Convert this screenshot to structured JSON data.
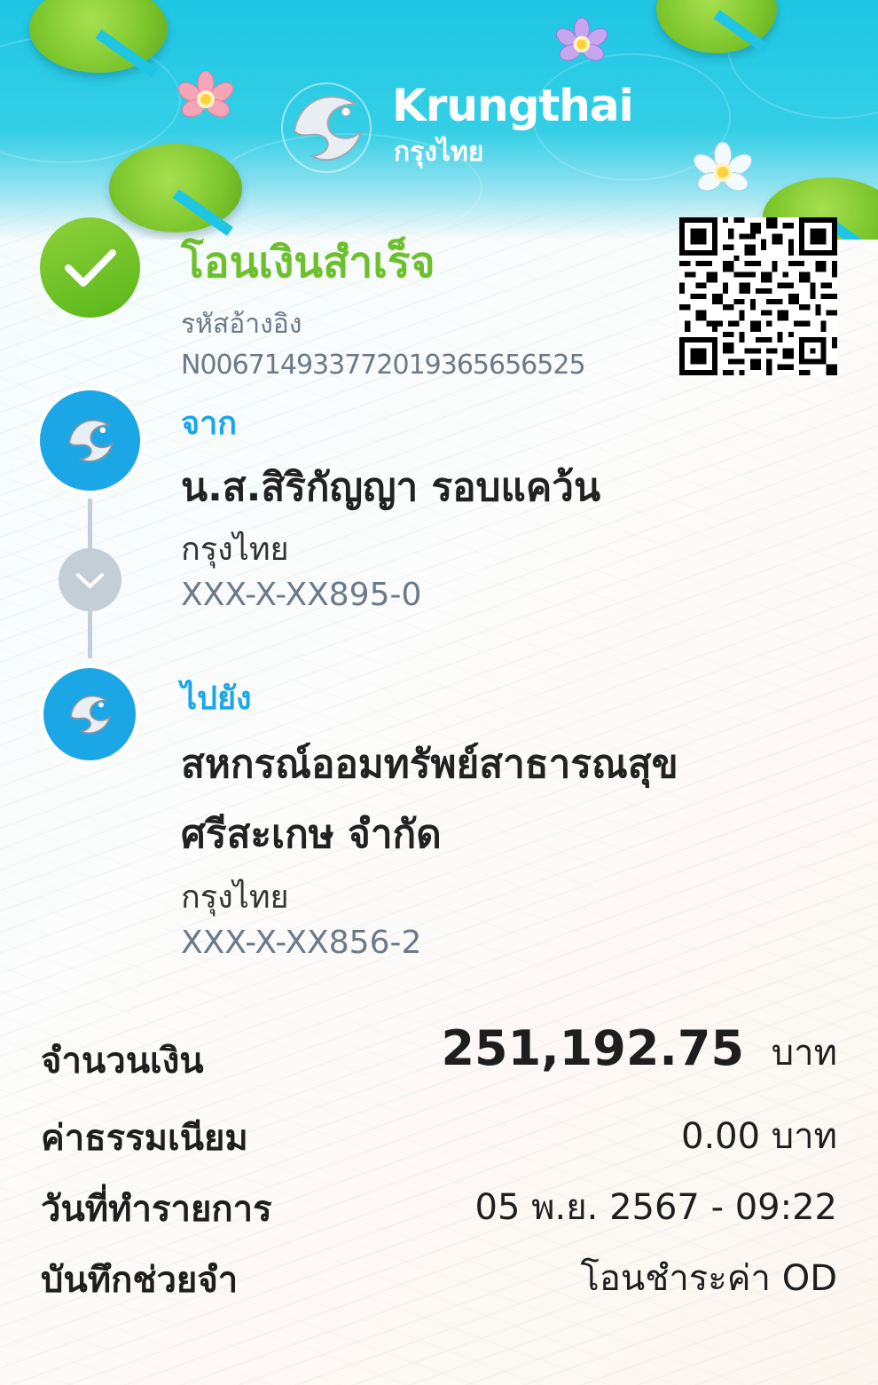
{
  "brand": {
    "name_en": "Krungthai",
    "name_th": "กรุงไทย"
  },
  "status": {
    "title": "โอนเงินสำเร็จ",
    "ref_label": "รหัสอ้างอิง",
    "ref_number": "N006714933772019365656525"
  },
  "from": {
    "label": "จาก",
    "name": "น.ส.สิริกัญญา รอบแคว้น",
    "bank": "กรุงไทย",
    "account": "XXX-X-XX895-0"
  },
  "to": {
    "label": "ไปยัง",
    "name_line1": "สหกรณ์ออมทรัพย์สาธารณสุข",
    "name_line2": "ศรีสะเกษ จำกัด",
    "bank": "กรุงไทย",
    "account": "XXX-X-XX856-2"
  },
  "details": {
    "amount_label": "จำนวนเงิน",
    "amount_value": "251,192.75",
    "amount_unit": "บาท",
    "fee_label": "ค่าธรรมเนียม",
    "fee_value": "0.00 บาท",
    "date_label": "วันที่ทำรายการ",
    "date_value": "05 พ.ย. 2567 - 09:22",
    "memo_label": "บันทึกช่วยจำ",
    "memo_value": "โอนชำระค่า OD"
  },
  "colors": {
    "header": "#1ec6e4",
    "success": "#6cc02c",
    "accent_blue": "#1aa6e8"
  },
  "icons": {
    "status": "check-icon",
    "connector": "chevron-down-icon",
    "bank_logo": "krungthai-bird-logo"
  }
}
